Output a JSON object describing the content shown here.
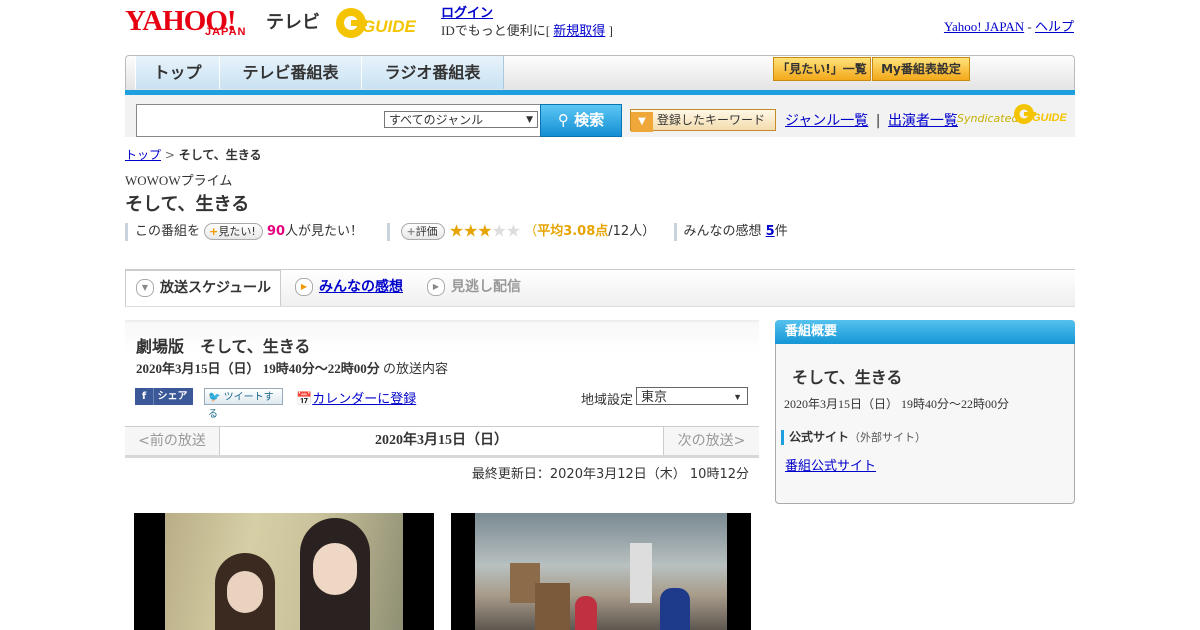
{
  "header": {
    "logo_yahoo": "YAHOO!",
    "logo_japan": "JAPAN",
    "logo_tv": "テレビ",
    "gguide_label": "GUIDE",
    "login": "ログイン",
    "id_prefix": "IDでもっと便利に[ ",
    "signup": "新規取得",
    "id_suffix": " ]",
    "yahoo_japan": "Yahoo! JAPAN",
    "sep": " - ",
    "help": "ヘルプ"
  },
  "nav": {
    "tabs": [
      "トップ",
      "テレビ番組表",
      "ラジオ番組表"
    ],
    "want_list": "「見たい!」一覧",
    "my_schedule": "My番組表設定"
  },
  "search": {
    "genre": "すべてのジャンル",
    "button": "検索",
    "keyword_button": "登録したキーワード",
    "genre_list": "ジャンル一覧",
    "divider": "|",
    "cast_list": "出演者一覧",
    "syndicated": "Syndicated"
  },
  "breadcrumb": {
    "top": "トップ",
    "sep": " > ",
    "current": "そして、生きる"
  },
  "program": {
    "channel": "WOWOWプライム",
    "title": "そして、生きる",
    "want_prefix": "この番組を",
    "want_pill": "見たい!",
    "want_count": "90",
    "want_suffix": "人が見たい！",
    "rate_pill": "評価",
    "rating": 3.08,
    "avg_prefix": "（",
    "avg_label": "平均3.08点",
    "avg_suffix": "/12人）",
    "reviews_prefix": "みんなの感想 ",
    "reviews_count": "5",
    "reviews_suffix": "件"
  },
  "tabs": {
    "schedule": "放送スケジュール",
    "reviews": "みんなの感想",
    "streaming": "見逃し配信"
  },
  "broadcast": {
    "title": "劇場版　そして、生きる",
    "datetime": "2020年3月15日（日） 19時40分～22時00分",
    "datetime_suffix": " の放送内容",
    "share": "シェア",
    "tweet": "ツイートする",
    "calendar": "カレンダーに登録",
    "region_label": "地域設定",
    "region": "東京",
    "prev": "<前の放送",
    "current_date": "2020年3月15日（日）",
    "next": "次の放送>",
    "updated": "最終更新日：2020年3月12日（木） 10時12分"
  },
  "overview": {
    "header": "番組概要",
    "title": "そして、生きる",
    "datetime": "2020年3月15日（日） 19時40分～22時00分",
    "site_label": "公式サイト",
    "site_sub": "（外部サイト）",
    "site_link": "番組公式サイト"
  },
  "colors": {
    "brand_red": "#e60012",
    "accent_blue": "#1ea0e0",
    "star": "#e6a400",
    "pink": "#e4007f"
  }
}
